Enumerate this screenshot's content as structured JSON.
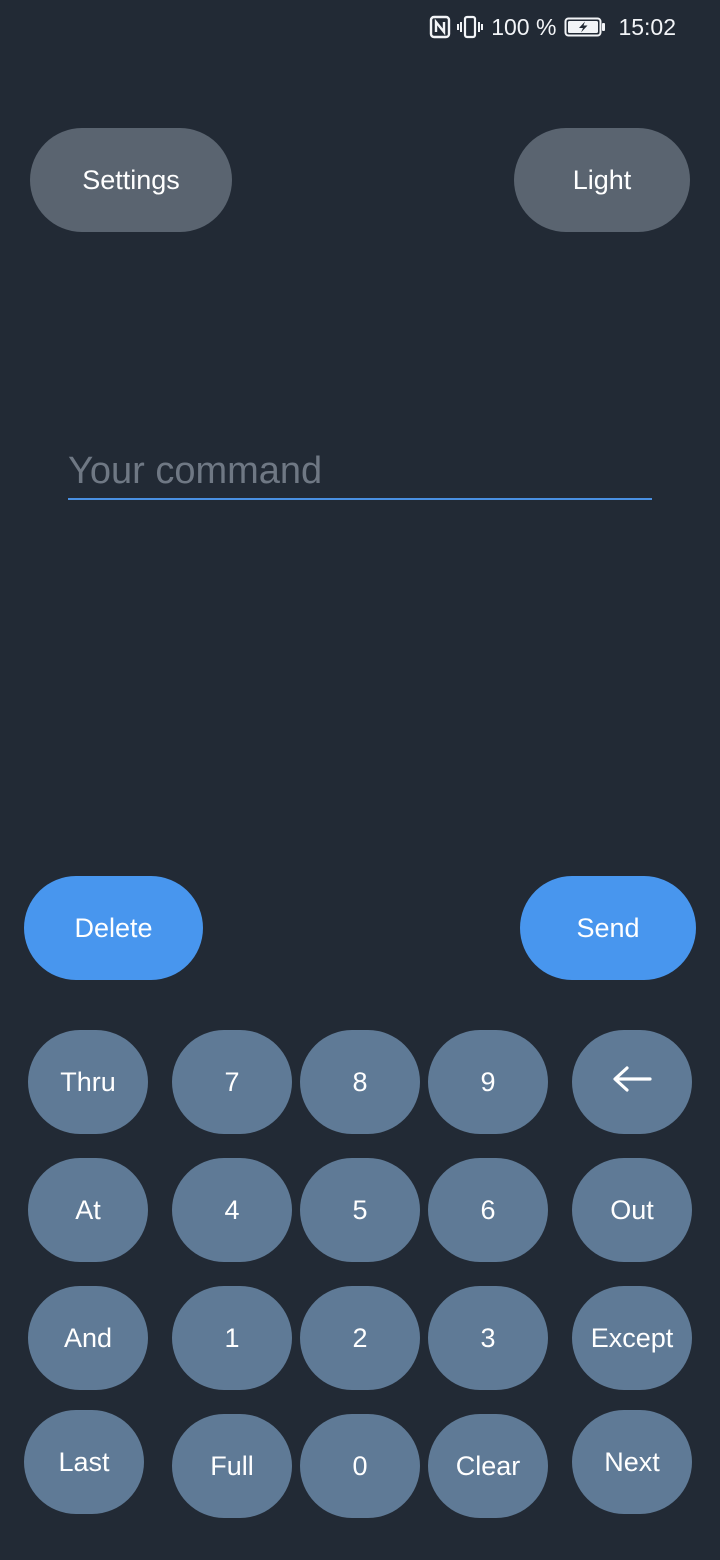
{
  "status_bar": {
    "battery_percent": "100 %",
    "time": "15:02",
    "icons": [
      "nfc-icon",
      "vibrate-icon",
      "battery-charging-icon"
    ]
  },
  "top": {
    "settings_label": "Settings",
    "theme_label": "Light"
  },
  "command": {
    "value": "",
    "placeholder": "Your command"
  },
  "actions": {
    "delete_label": "Delete",
    "send_label": "Send"
  },
  "keypad": {
    "row1": [
      "Thru",
      "7",
      "8",
      "9",
      "←"
    ],
    "row2": [
      "At",
      "4",
      "5",
      "6",
      "Out"
    ],
    "row3": [
      "And",
      "1",
      "2",
      "3",
      "Except"
    ],
    "row4": [
      "Last",
      "Full",
      "0",
      "Clear",
      "Next"
    ]
  },
  "colors": {
    "background": "#222a35",
    "gray_button": "#5a6470",
    "accent_blue": "#4896ee",
    "key_button": "#5f7a96"
  }
}
